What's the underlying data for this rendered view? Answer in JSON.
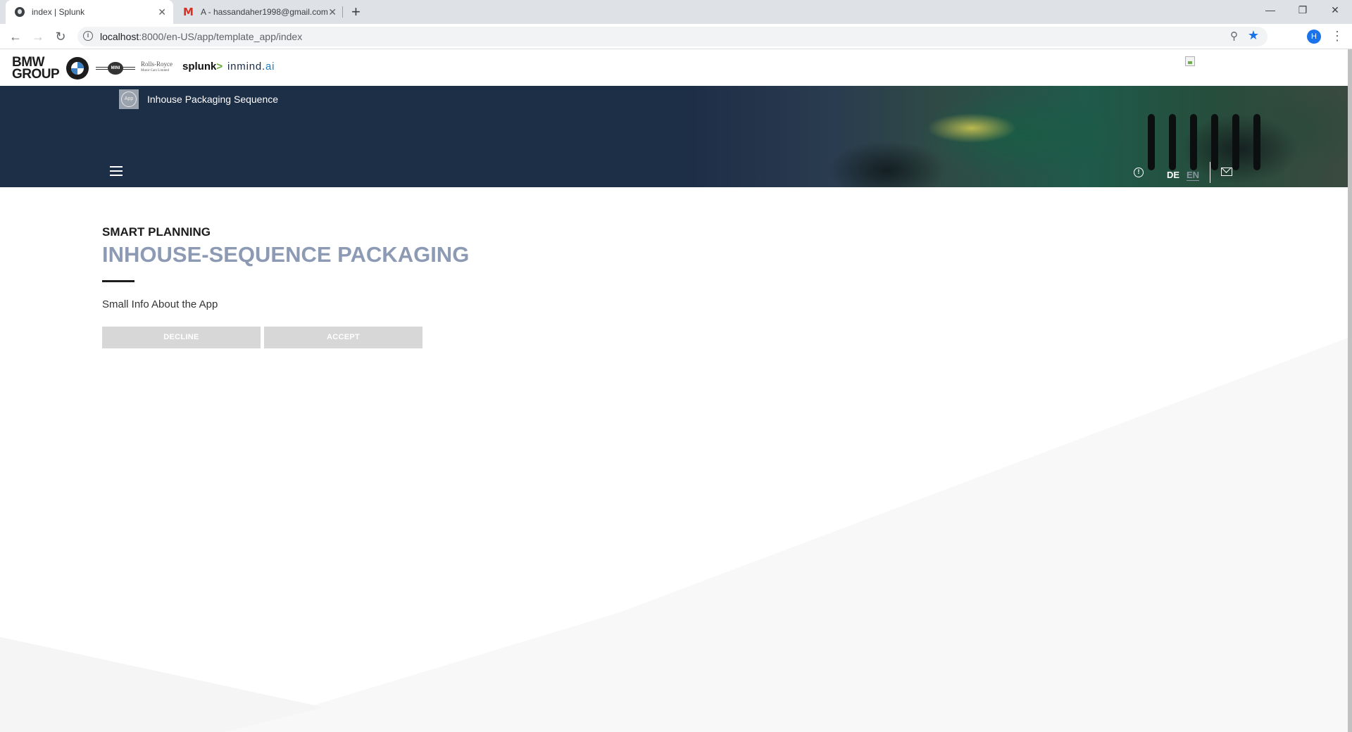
{
  "browser": {
    "tabs": [
      {
        "title": "index | Splunk",
        "active": true
      },
      {
        "title": "A - hassandaher1998@gmail.com",
        "active": false
      }
    ],
    "new_tab_label": "+",
    "window_controls": {
      "minimize": "—",
      "restore": "❐",
      "close": "✕"
    },
    "url_host": "localhost",
    "url_rest": ":8000/en-US/app/template_app/index",
    "profile_initial": "H"
  },
  "brands": {
    "bmw_group_line1": "BMW",
    "bmw_group_line2": "GROUP",
    "mini": "MINI",
    "rolls_royce": "Rolls-Royce",
    "rolls_royce_sub": "Motor Cars Limited",
    "splunk": "splunk",
    "splunk_arrow": ">",
    "inmind": "inmind.",
    "inmind_ai": "ai"
  },
  "header": {
    "app_badge": "App",
    "app_title": "Inhouse Packaging Sequence",
    "lang_de": "DE",
    "lang_en": "EN",
    "info_symbol": "!"
  },
  "main": {
    "eyebrow": "SMART PLANNING",
    "title": "INHOUSE-SEQUENCE PACKAGING",
    "info": "Small Info About the App",
    "decline_label": "DECLINE",
    "accept_label": "ACCEPT"
  },
  "colors": {
    "header_bg": "#1d2e47",
    "title_color": "#8c9ab4",
    "button_bg": "#d7d7d7"
  }
}
